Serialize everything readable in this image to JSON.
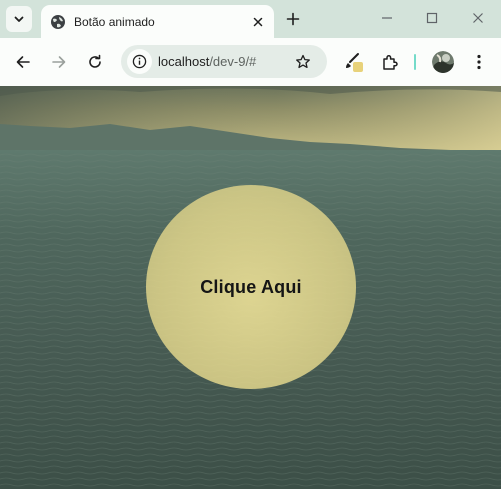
{
  "browser": {
    "tab_title": "Botão animado",
    "url_host": "localhost",
    "url_path": "/dev-9/#",
    "icons": {
      "tab_menu": "chevron-down-icon",
      "favicon": "globe-icon",
      "close": "close-icon",
      "new_tab": "plus-icon",
      "minimize": "minimize-icon",
      "maximize": "maximize-icon",
      "window_close": "close-icon",
      "back": "back-arrow-icon",
      "forward": "forward-arrow-icon",
      "reload": "reload-icon",
      "site_info": "info-icon",
      "bookmark": "star-icon",
      "extension_paint": "paint-brush-icon",
      "extensions": "puzzle-icon",
      "more": "kebab-menu-icon"
    },
    "colors": {
      "tabstrip": "#d3e3da",
      "toolbar": "#fbfdfb",
      "omnibox": "#e4ece7",
      "separator": "#74dbc9"
    }
  },
  "page": {
    "button_label": "Clique Aqui",
    "colors": {
      "button_fill": "#e2d68c",
      "button_text": "#151515",
      "sea": "#4a5f57",
      "sky": "#c9bf86"
    }
  }
}
